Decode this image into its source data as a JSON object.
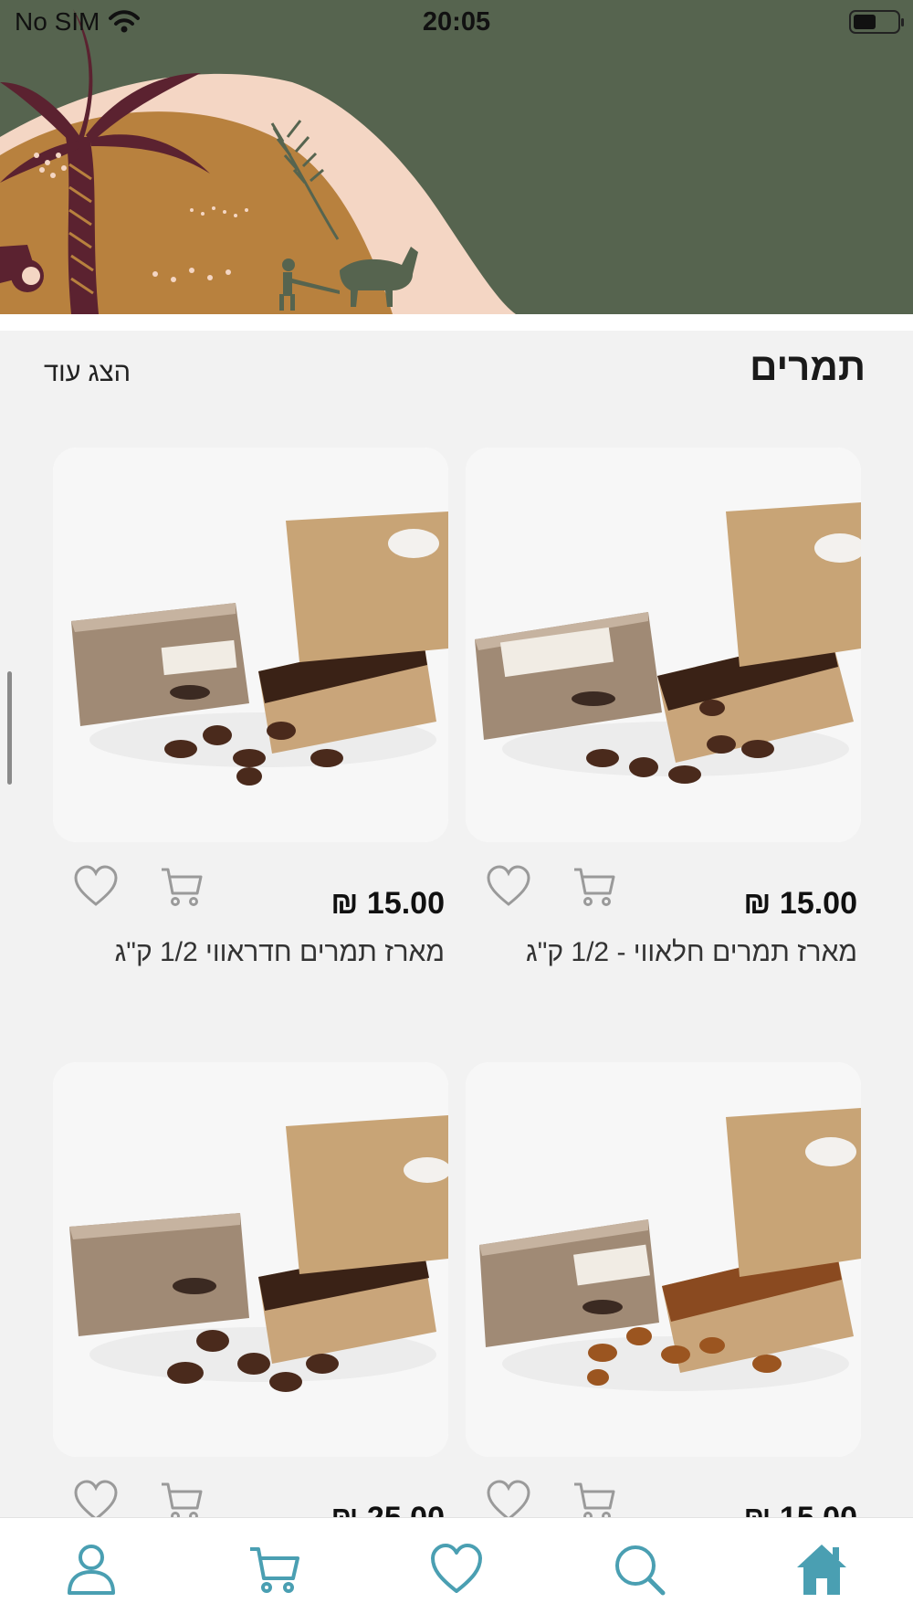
{
  "status_bar": {
    "carrier": "No SIM",
    "time": "20:05",
    "battery_level": 0.5
  },
  "section": {
    "title": "תמרים",
    "show_more": "הצג עוד"
  },
  "products": [
    {
      "title": "מארז תמרים חלאווי - 1/2 ק\"ג",
      "price": "₪ 15.00"
    },
    {
      "title": "מארז תמרים חדראווי 1/2 ק\"ג",
      "price": "₪ 15.00"
    },
    {
      "title": "",
      "price": "₪ 15.00"
    },
    {
      "title": "",
      "price": "₪ 25.00"
    }
  ],
  "bottom_nav": {
    "items": [
      "home-icon",
      "search-icon",
      "heart-icon",
      "cart-icon",
      "user-icon"
    ],
    "accent": "#4a9fb2"
  },
  "colors": {
    "banner_bg": "#56644f",
    "hill": "#b8813e",
    "sand": "#f4d6c4",
    "palm": "#5b2230",
    "page_bg": "#f2f2f2"
  }
}
